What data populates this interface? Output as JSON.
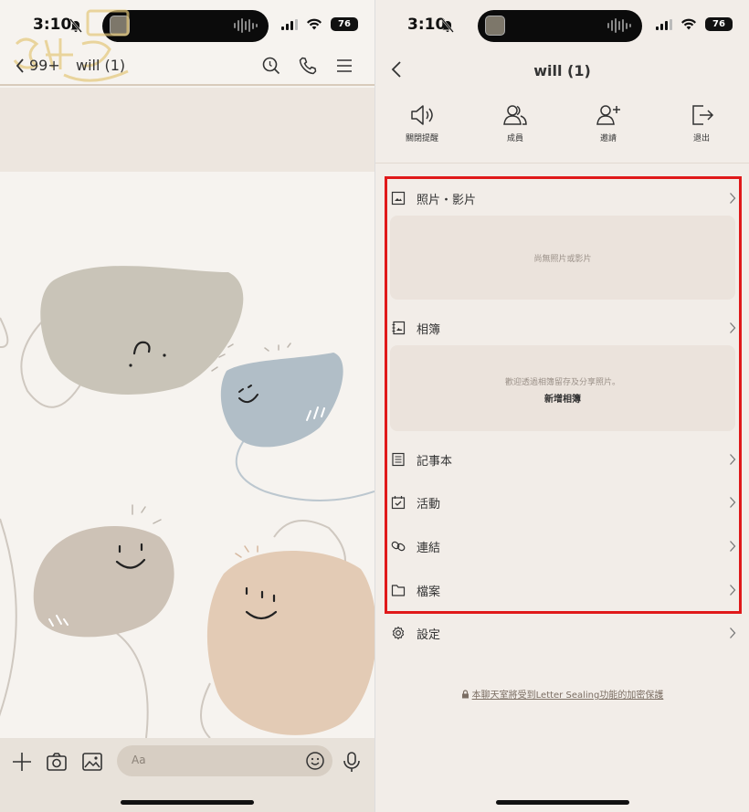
{
  "left": {
    "status": {
      "time": "3:10",
      "battery": "76"
    },
    "chat": {
      "back_count": "99+",
      "title": "will (1)"
    },
    "input": {
      "placeholder": "Aa"
    }
  },
  "right": {
    "status": {
      "time": "3:10",
      "battery": "76"
    },
    "title": "will (1)",
    "actions": [
      {
        "label": "關閉提醒",
        "icon": "speaker-icon"
      },
      {
        "label": "成員",
        "icon": "members-icon"
      },
      {
        "label": "邀請",
        "icon": "add-user-icon"
      },
      {
        "label": "退出",
        "icon": "exit-icon"
      }
    ],
    "sections": {
      "photos": {
        "label": "照片・影片",
        "empty_text": "尚無照片或影片"
      },
      "albums": {
        "label": "相簿",
        "hint_text": "歡迎透過相簿留存及分享照片。",
        "create_label": "新增相簿"
      },
      "notes": {
        "label": "記事本"
      },
      "events": {
        "label": "活動"
      },
      "links": {
        "label": "連結"
      },
      "files": {
        "label": "檔案"
      },
      "settings": {
        "label": "設定"
      }
    },
    "footer_note": "本聊天室將受到Letter Sealing功能的加密保護"
  },
  "highlight_color": "#e0191a"
}
